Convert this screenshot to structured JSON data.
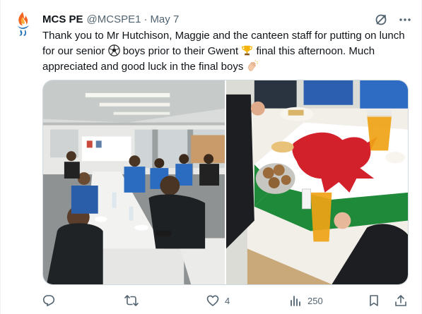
{
  "author": {
    "name": "MCS PE",
    "handle": "@MCSPE1",
    "separator": "·",
    "date": "May 7",
    "avatar_icon": "flame-logo-icon"
  },
  "tweet": {
    "text_part1": "Thank you to Mr Hutchison, Maggie and the canteen staff for putting on lunch for our senior ",
    "emoji1": "soccer-ball-emoji",
    "text_part2": " boys prior to their Gwent ",
    "emoji2": "trophy-emoji",
    "text_part3": " final this afternoon. Much appreciated and good luck in the final boys ",
    "emoji3": "clapping-hands-emoji"
  },
  "media": {
    "photos": [
      {
        "icon": "canteen-photo",
        "description_visible": false
      },
      {
        "icon": "food-table-welsh-flag-photo",
        "description_visible": false
      }
    ]
  },
  "actions": {
    "reply_count": "",
    "retweet_count": "",
    "like_count": "4",
    "views_count": "250"
  },
  "colors": {
    "text": "#0f1419",
    "secondary": "#536471",
    "border": "#cfd9de"
  }
}
